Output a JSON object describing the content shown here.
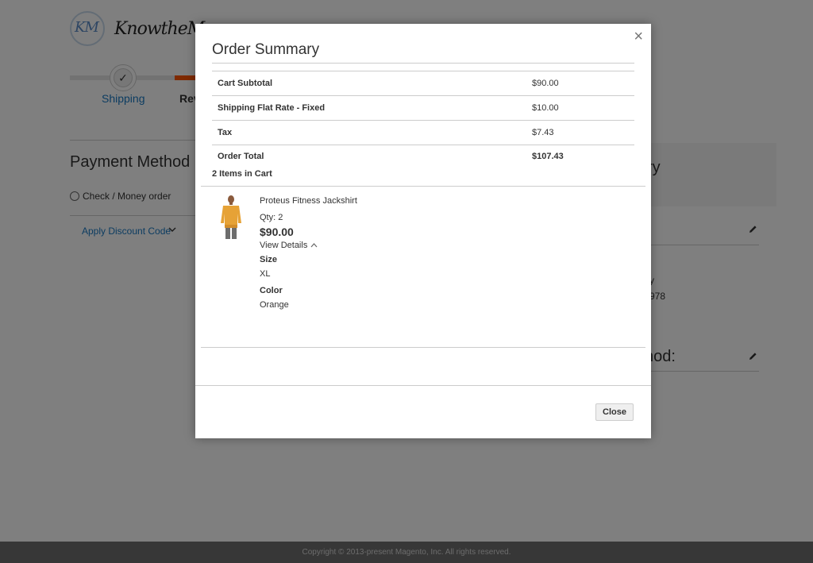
{
  "header": {
    "logo_mark": "KM",
    "logo_text": "KnowtheMage"
  },
  "progress": {
    "steps": [
      {
        "label": "Shipping",
        "state": "complete"
      },
      {
        "label": "Review",
        "state": "active",
        "visible_text": "Rev"
      }
    ],
    "check_glyph": "✓",
    "accent_color": "#ff5501"
  },
  "payment": {
    "title": "Payment Method",
    "options": [
      {
        "label": "Check / Money order"
      }
    ],
    "discount_link": "Apply Discount Code"
  },
  "sidebar_fragments": {
    "summary_title_fragment": "ry",
    "address_fragment_1": "y",
    "address_fragment_2": "978",
    "method_fragment": "nod:",
    "edit_icon": "pencil-icon"
  },
  "modal": {
    "title": "Order Summary",
    "close_glyph": "×",
    "totals": [
      {
        "label": "Cart Subtotal",
        "value": "$90.00"
      },
      {
        "label": "Shipping Flat Rate - Fixed",
        "value": "$10.00"
      },
      {
        "label": "Tax",
        "value": "$7.43"
      },
      {
        "label": "Order Total",
        "value": "$107.43"
      }
    ],
    "items_count": "2 Items in Cart",
    "item": {
      "name": "Proteus Fitness Jackshirt",
      "qty": "Qty: 2",
      "price": "$90.00",
      "view_details": "View Details",
      "options": [
        {
          "label": "Size",
          "value": "XL"
        },
        {
          "label": "Color",
          "value": "Orange"
        }
      ]
    },
    "close_button": "Close"
  },
  "footer": {
    "copyright": "Copyright © 2013-present Magento, Inc. All rights reserved."
  }
}
